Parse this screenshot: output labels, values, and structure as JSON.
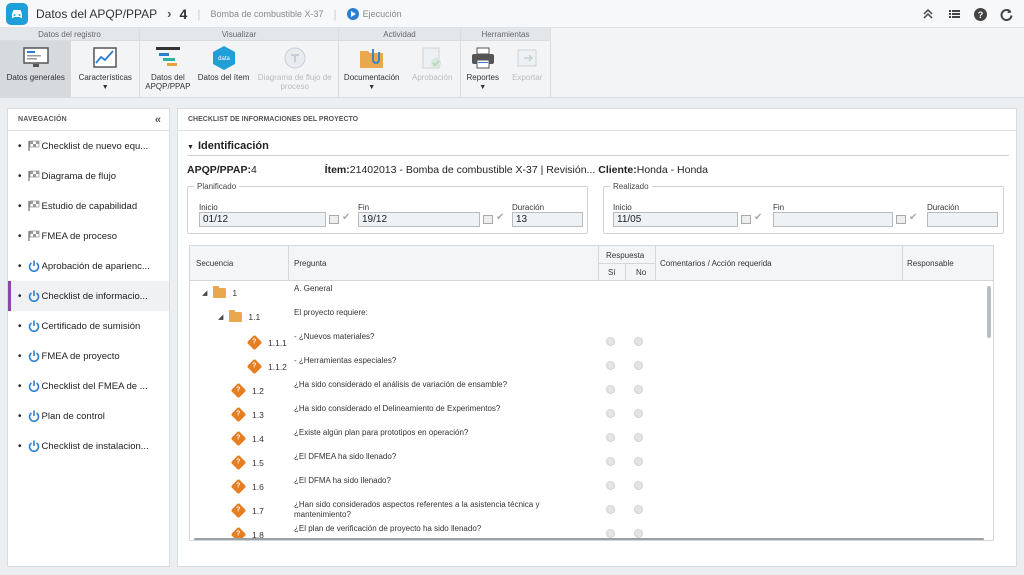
{
  "titlebar": {
    "app_title": "Datos del APQP/PPAP",
    "record_number": "4",
    "subtitle": "Bomba de combustible X-37",
    "status": "Ejecución"
  },
  "ribbon": {
    "groups": [
      {
        "title": "Datos del registro",
        "buttons": [
          {
            "label": "Datos generales",
            "state": "active"
          },
          {
            "label": "Características",
            "dropdown": true
          }
        ]
      },
      {
        "title": "Visualizar",
        "buttons": [
          {
            "label": "Datos del APQP/PPAP"
          },
          {
            "label": "Datos del ítem"
          },
          {
            "label": "Diagrama de flujo de proceso",
            "state": "disabled"
          }
        ]
      },
      {
        "title": "Actividad",
        "buttons": [
          {
            "label": "Documentación",
            "dropdown": true
          },
          {
            "label": "Aprobación",
            "state": "disabled"
          }
        ]
      },
      {
        "title": "Herramientas",
        "buttons": [
          {
            "label": "Reportes",
            "dropdown": true
          },
          {
            "label": "Exportar",
            "state": "disabled"
          }
        ]
      }
    ]
  },
  "nav": {
    "title": "NAVEGACIÓN",
    "items": [
      {
        "label": "Checklist de nuevo equ...",
        "icon": "flag-icon"
      },
      {
        "label": "Diagrama de flujo",
        "icon": "flag-icon"
      },
      {
        "label": "Estudio de capabilidad",
        "icon": "flag-icon"
      },
      {
        "label": "FMEA de proceso",
        "icon": "flag-icon"
      },
      {
        "label": "Aprobación de aparienc...",
        "icon": "power-icon"
      },
      {
        "label": "Checklist de informacio...",
        "icon": "power-icon",
        "active": true
      },
      {
        "label": "Certificado de sumisión",
        "icon": "power-icon"
      },
      {
        "label": "FMEA de proyecto",
        "icon": "power-icon"
      },
      {
        "label": "Checklist del FMEA de ...",
        "icon": "power-icon"
      },
      {
        "label": "Plan de control",
        "icon": "power-icon"
      },
      {
        "label": "Checklist de instalacion...",
        "icon": "power-icon"
      }
    ]
  },
  "main": {
    "title": "CHECKLIST DE INFORMACIONES DEL PROYECTO",
    "section_title": "Identificación",
    "apqp_label": "APQP/PPAP:",
    "apqp_value": "4",
    "item_label": "Ítem:",
    "item_value": "21402013 - Bomba de combustible X-37 | Revisión...",
    "client_label": "Cliente:",
    "client_value": "Honda - Honda",
    "planificado": {
      "legend": "Planificado",
      "inicio_label": "Inicio",
      "inicio": "01/12",
      "fin_label": "Fin",
      "fin": "19/12",
      "duracion_label": "Duración",
      "duracion": "13"
    },
    "realizado": {
      "legend": "Realizado",
      "inicio_label": "Inicio",
      "inicio": "11/05",
      "fin_label": "Fin",
      "fin": "",
      "duracion_label": "Duración",
      "duracion": ""
    }
  },
  "table": {
    "headers": {
      "secuencia": "Secuencia",
      "pregunta": "Pregunta",
      "respuesta": "Respuesta",
      "si": "Sí",
      "no": "No",
      "comentarios": "Comentarios / Acción requerida",
      "responsable": "Responsable"
    },
    "rows": [
      {
        "seq": "1",
        "question": "A. General",
        "level": 0,
        "type": "folder",
        "expanded": true,
        "radios": false
      },
      {
        "seq": "1.1",
        "question": "El proyecto requiere:",
        "level": 1,
        "type": "folder",
        "expanded": true,
        "radios": false
      },
      {
        "seq": "1.1.1",
        "question": "- ¿Nuevos materiales?",
        "level": 2,
        "type": "question",
        "radios": true
      },
      {
        "seq": "1.1.2",
        "question": "- ¿Herramientas especiales?",
        "level": 2,
        "type": "question",
        "radios": true
      },
      {
        "seq": "1.2",
        "question": "¿Ha sido considerado el análisis de variación de ensamble?",
        "level": 1,
        "type": "question",
        "radios": true
      },
      {
        "seq": "1.3",
        "question": "¿Ha sido considerado el Delineamiento de Experimentos?",
        "level": 1,
        "type": "question",
        "radios": true
      },
      {
        "seq": "1.4",
        "question": "¿Existe algún plan para prototipos en operación?",
        "level": 1,
        "type": "question",
        "radios": true
      },
      {
        "seq": "1.5",
        "question": "¿El DFMEA ha sido llenado?",
        "level": 1,
        "type": "question",
        "radios": true
      },
      {
        "seq": "1.6",
        "question": "¿El DFMA ha sido llenado?",
        "level": 1,
        "type": "question",
        "radios": true
      },
      {
        "seq": "1.7",
        "question": "¿Han sido considerados aspectos referentes a la asistencia técnica y mantenimiento?",
        "level": 1,
        "type": "question",
        "radios": true
      },
      {
        "seq": "1.8",
        "question": "¿El plan de verificación de proyecto ha sido llenado?",
        "level": 1,
        "type": "question",
        "radios": true
      }
    ]
  }
}
